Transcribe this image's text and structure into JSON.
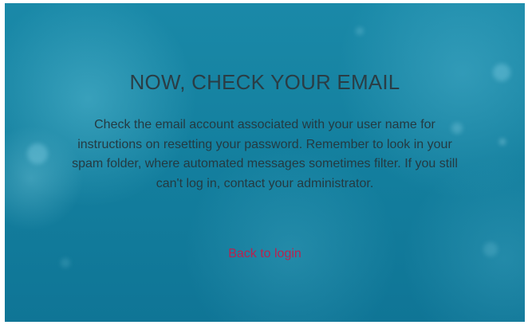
{
  "heading": "NOW, CHECK YOUR EMAIL",
  "message": "Check the email account associated with your user name for instructions on resetting your password. Remember to look in your spam folder, where automated messages sometimes filter. If you still can't log in, contact your administrator.",
  "back_link_label": "Back to login",
  "colors": {
    "background": "#14809f",
    "text": "#243a42",
    "link": "#b8234f"
  }
}
